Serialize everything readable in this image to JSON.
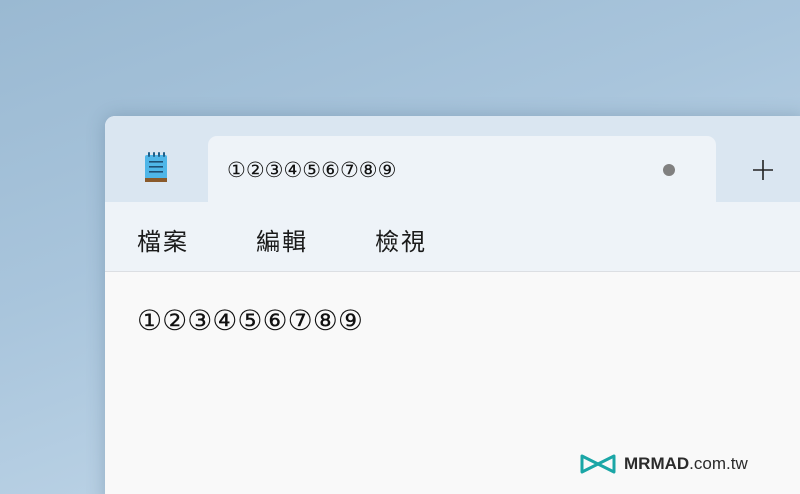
{
  "tab": {
    "title": "①②③④⑤⑥⑦⑧⑨",
    "unsaved_indicator": "unsaved-dot-icon",
    "new_tab_icon": "plus-icon"
  },
  "app_icon": "notepad-icon",
  "menu": {
    "items": [
      {
        "label": "檔案"
      },
      {
        "label": "編輯"
      },
      {
        "label": "檢視"
      }
    ]
  },
  "editor": {
    "content": "①②③④⑤⑥⑦⑧⑨"
  },
  "watermark": {
    "brand": "MRMAD",
    "suffix": ".com.tw"
  },
  "colors": {
    "titlebar": "#dae6f1",
    "tab": "#eef3f8",
    "editor_bg": "#f9f9f9",
    "watermark_accent": "#1aa6a6"
  }
}
